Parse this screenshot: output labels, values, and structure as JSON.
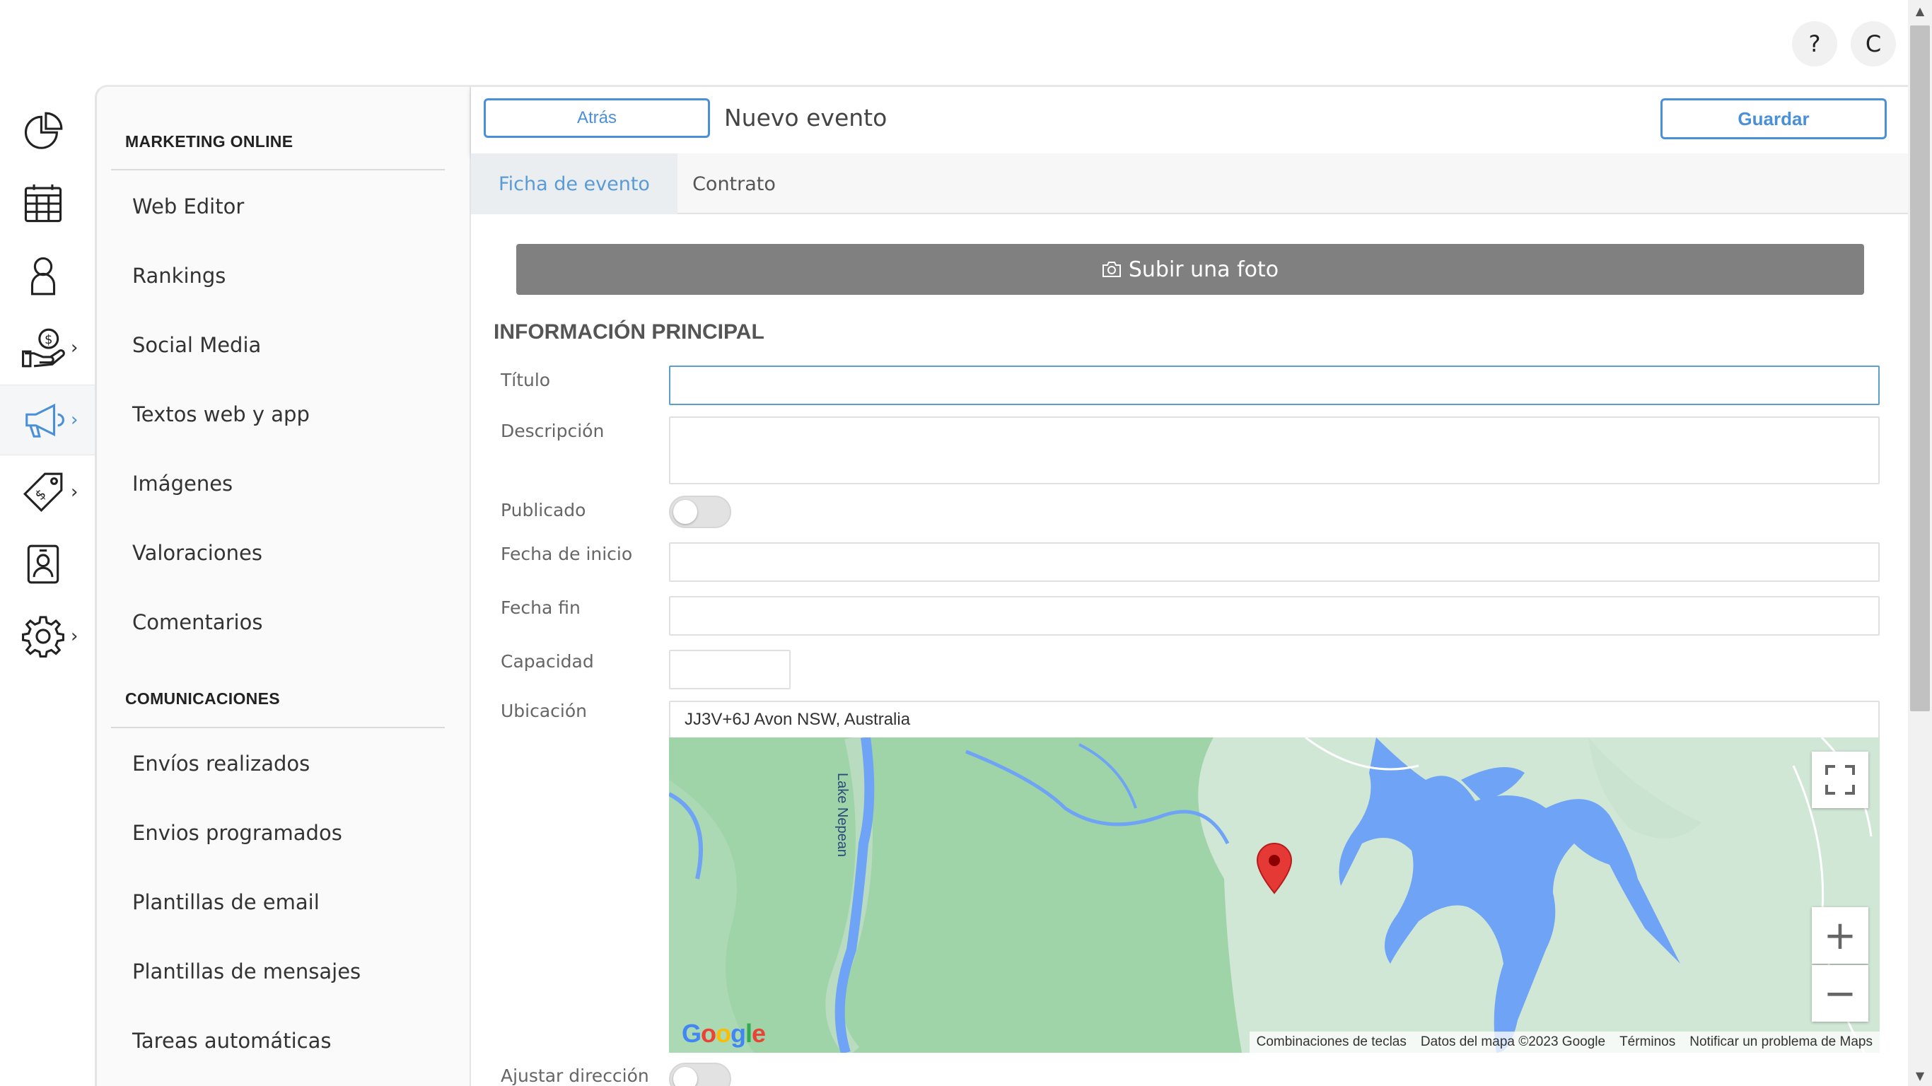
{
  "header": {
    "help_label": "?",
    "user_initial": "C"
  },
  "rail": {
    "items": [
      {
        "icon": "pie-chart-icon"
      },
      {
        "icon": "calendar-grid-icon"
      },
      {
        "icon": "user-icon"
      },
      {
        "icon": "money-hand-icon",
        "chevron": "›"
      },
      {
        "icon": "megaphone-icon",
        "chevron": "›",
        "active": true
      },
      {
        "icon": "price-tag-icon",
        "chevron": "›"
      },
      {
        "icon": "id-badge-icon"
      },
      {
        "icon": "gear-icon",
        "chevron": "›"
      }
    ],
    "active_color": "#4a90d9"
  },
  "submenu": {
    "section1": "MARKETING ONLINE",
    "items1": [
      "Web Editor",
      "Rankings",
      "Social Media",
      "Textos web y app",
      "Imágenes",
      "Valoraciones",
      "Comentarios"
    ],
    "section2": "COMUNICACIONES",
    "items2": [
      "Envíos realizados",
      "Envios programados",
      "Plantillas de email",
      "Plantillas de mensajes",
      "Tareas automáticas"
    ]
  },
  "toolbar": {
    "back_label": "Atrás",
    "title": "Nuevo evento",
    "save_label": "Guardar"
  },
  "tabs": [
    {
      "label": "Ficha de evento",
      "active": true
    },
    {
      "label": "Contrato",
      "active": false
    }
  ],
  "upload": {
    "label": "Subir una foto",
    "icon": "camera-icon"
  },
  "form": {
    "section_title": "INFORMACIÓN PRINCIPAL",
    "labels": {
      "title": "Título",
      "description": "Descripción",
      "published": "Publicado",
      "start_date": "Fecha de inicio",
      "end_date": "Fecha fin",
      "capacity": "Capacidad",
      "location": "Ubicación",
      "adjust_address": "Ajustar dirección"
    },
    "values": {
      "title": "",
      "description": "",
      "published": false,
      "start_date": "",
      "end_date": "",
      "capacity": "",
      "location": "JJ3V+6J Avon NSW, Australia",
      "adjust_address": false
    }
  },
  "map": {
    "lake_label": "Lake Nepean",
    "logo": "Google",
    "attribution": {
      "shortcuts": "Combinaciones de teclas",
      "data": "Datos del mapa ©2023 Google",
      "terms": "Términos",
      "report": "Notificar un problema de Maps"
    },
    "zoom_in": "+",
    "zoom_out": "−",
    "colors": {
      "land": "#9fd4a9",
      "land_light": "#d1e7d6",
      "water": "#6fa3f5",
      "marker": "#e53935"
    }
  }
}
